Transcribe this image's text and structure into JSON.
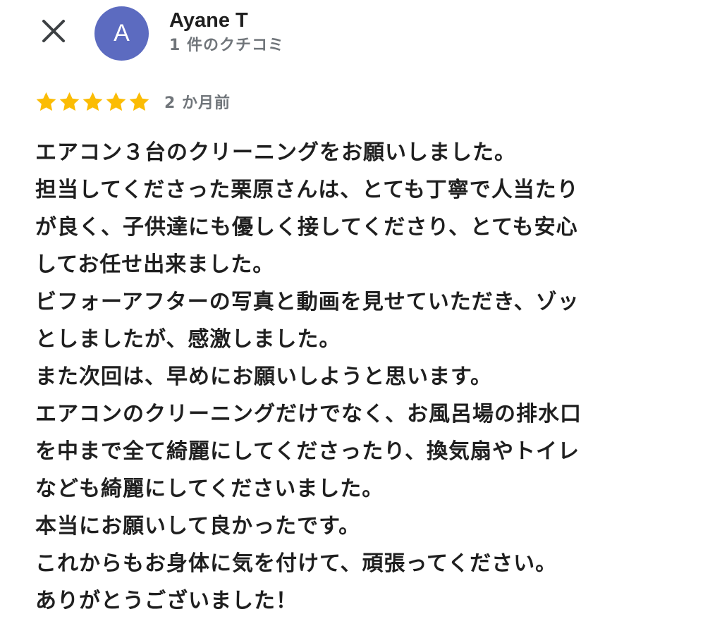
{
  "header": {
    "close_icon": "close-icon",
    "avatar_letter": "A",
    "avatar_color": "#5c6bc0",
    "reviewer_name": "Ayane T",
    "review_count": "1 件のクチコミ"
  },
  "review": {
    "rating": 5,
    "max_rating": 5,
    "star_color": "#fbbc04",
    "date": "2 か月前",
    "lines": [
      "エアコン３台のクリーニングをお願いしました。",
      "担当してくださった栗原さんは、とても丁寧で人当たり",
      "が良く、子供達にも優しく接してくださり、とても安心",
      "してお任せ出来ました。",
      "ビフォーアフターの写真と動画を見せていただき、ゾッ",
      "としましたが、感激しました。",
      "また次回は、早めにお願いしようと思います。",
      "エアコンのクリーニングだけでなく、お風呂場の排水口",
      "を中まで全て綺麗にしてくださったり、換気扇やトイレ",
      "なども綺麗にしてくださいました。",
      "本当にお願いして良かったです。",
      "これからもお身体に気を付けて、頑張ってください。",
      "ありがとうございました！"
    ]
  }
}
